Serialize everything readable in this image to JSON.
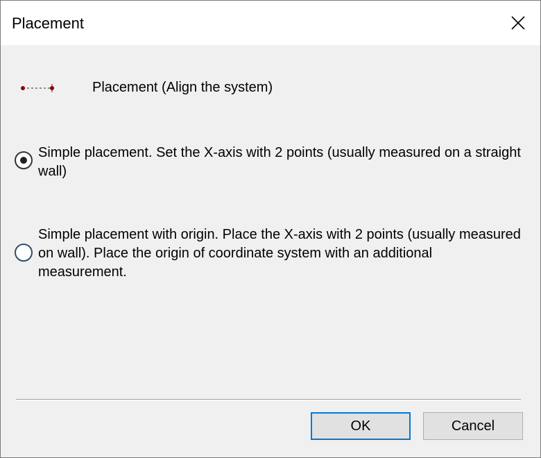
{
  "window": {
    "title": "Placement"
  },
  "header": {
    "icon": "dotted-line-points-icon",
    "text": "Placement (Align the system)"
  },
  "options": [
    {
      "label": "Simple placement. Set the X-axis with 2 points (usually measured on a straight wall)",
      "selected": true
    },
    {
      "label": "Simple placement with origin. Place the X-axis with 2 points (usually measured on wall). Place the origin of coordinate system with an additional measurement.",
      "selected": false
    }
  ],
  "buttons": {
    "ok": "OK",
    "cancel": "Cancel"
  },
  "colors": {
    "dialog_bg": "#f0f0f0",
    "titlebar_bg": "#ffffff",
    "default_button_border": "#0078d7",
    "icon_point": "#8b0000"
  }
}
